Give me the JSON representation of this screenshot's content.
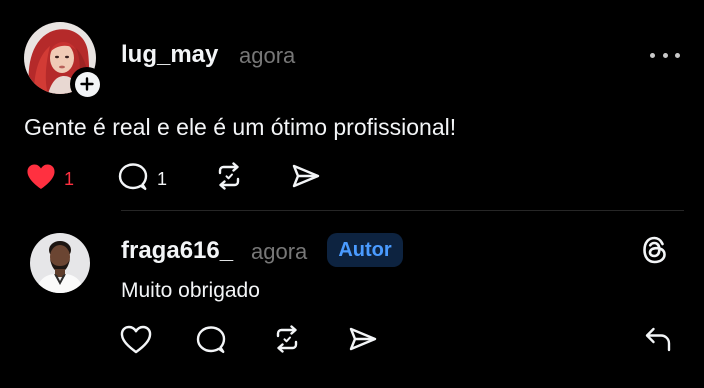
{
  "post": {
    "username": "lug_may",
    "time": "agora",
    "text": "Gente é real e ele é um ótimo profissional!",
    "likes": "1",
    "comments": "1",
    "liked": true
  },
  "reply": {
    "username": "fraga616_",
    "time": "agora",
    "badge": "Autor",
    "text": "Muito obrigado"
  },
  "colors": {
    "background": "#000000",
    "text": "#f3f5f7",
    "secondary": "#777777",
    "like_red": "#ff3040",
    "author_badge_text": "#4a9bff",
    "author_badge_bg": "#0d2340"
  },
  "icons": {
    "post_actions": [
      "heart-filled-icon",
      "comment-icon",
      "repost-icon",
      "share-icon"
    ],
    "reply_actions": [
      "heart-icon",
      "comment-icon",
      "repost-icon",
      "share-icon",
      "reply-arrow-icon"
    ],
    "more": "more-dots-icon",
    "follow": "plus-icon",
    "brand": "threads-logo-icon"
  }
}
